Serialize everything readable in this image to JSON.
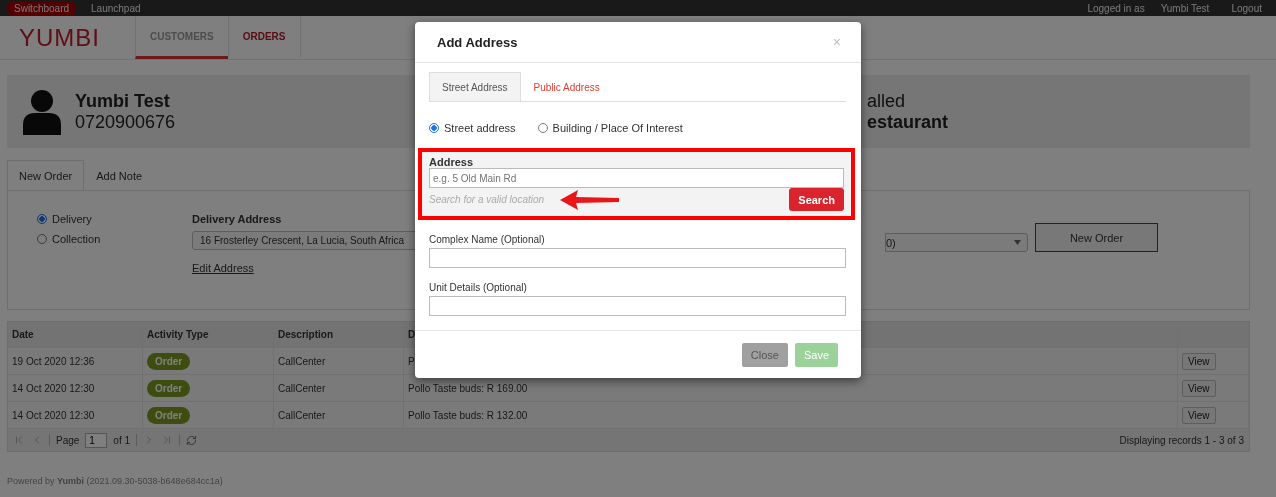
{
  "top_bar": {
    "links": [
      {
        "label": "Switchboard",
        "selected": true
      },
      {
        "label": "Launchpad",
        "selected": false
      }
    ],
    "logged_in_label": "Logged in as",
    "user": "Yumbi Test",
    "logout": "Logout"
  },
  "header": {
    "logo": "YUMBI",
    "tabs": [
      {
        "label": "CUSTOMERS",
        "selected": true
      },
      {
        "label": "ORDERS",
        "selected": false
      }
    ]
  },
  "customer": {
    "name": "Yumbi Test",
    "phone": "0720900676",
    "right_line_1": "alled",
    "right_line_2": "estaurant"
  },
  "order_tabs": [
    {
      "label": "New Order",
      "selected": true
    },
    {
      "label": "Add Note",
      "selected": false
    }
  ],
  "order_panel": {
    "methods": [
      {
        "label": "Delivery",
        "selected": true
      },
      {
        "label": "Collection",
        "selected": false
      }
    ],
    "address_label": "Delivery Address",
    "address_value": "16 Frosterley Crescent, La Lucia, South Africa",
    "edit_link": "Edit Address",
    "second_select_value": "0)",
    "new_order_button": "New Order"
  },
  "table": {
    "columns": [
      "Date",
      "Activity Type",
      "Description",
      "D",
      ""
    ],
    "rows": [
      {
        "date": "19 Oct 2020 12:36",
        "activity": "Order",
        "description": "CallCenter",
        "column_4": "P",
        "action": "View"
      },
      {
        "date": "14 Oct 2020 12:30",
        "activity": "Order",
        "description": "CallCenter",
        "column_4": "Pollo Taste buds: R 169.00",
        "action": "View"
      },
      {
        "date": "14 Oct 2020 12:30",
        "activity": "Order",
        "description": "CallCenter",
        "column_4": "Pollo Taste buds: R 132.00",
        "action": "View"
      }
    ],
    "pager": {
      "page_label": "Page",
      "page_value": "1",
      "of_label": "of 1",
      "summary": "Displaying records 1 - 3 of 3"
    }
  },
  "footer": {
    "text": "Powered by **Yumbi** (2021.09.30-5038-b648e684cc1a)"
  },
  "modal": {
    "title": "Add Address",
    "close": "×",
    "tabs": [
      {
        "label": "Street Address",
        "selected": true
      },
      {
        "label": "Public Address",
        "selected": false
      }
    ],
    "types": [
      {
        "label": "Street address",
        "selected": true
      },
      {
        "label": "Building / Place Of Interest",
        "selected": false
      }
    ],
    "address_label": "Address",
    "address_placeholder": "e.g. 5 Old Main Rd",
    "hint": "Search for a valid location",
    "search_button": "Search",
    "fields": [
      {
        "label": "Complex Name (Optional)"
      },
      {
        "label": "Unit Details (Optional)"
      }
    ],
    "buttons": [
      {
        "label": "Close",
        "kind": "secondary",
        "disabled": false
      },
      {
        "label": "Save",
        "kind": "primary",
        "disabled": true
      }
    ]
  }
}
